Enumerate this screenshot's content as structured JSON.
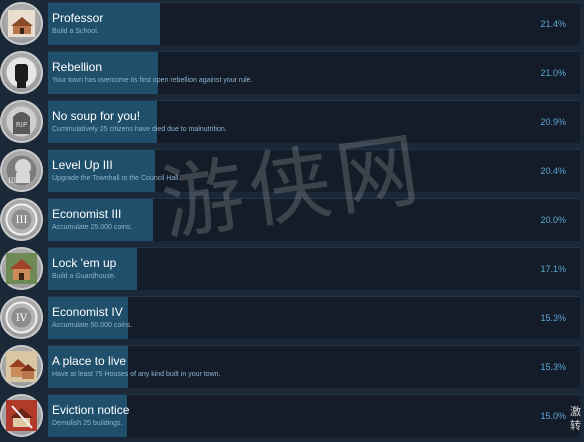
{
  "achievements": [
    {
      "title": "Professor",
      "description": "Build a School.",
      "percent": "21.4%",
      "fill": 0.214,
      "icon": "school-building-icon"
    },
    {
      "title": "Rebellion",
      "description": "Your town has overcome its first open rebellion against your rule.",
      "percent": "21.0%",
      "fill": 0.21,
      "icon": "raised-fist-icon"
    },
    {
      "title": "No soup for you!",
      "description": "Cummulatively 25 citizens have died due to malnutrition.",
      "percent": "20.9%",
      "fill": 0.209,
      "icon": "gravestone-rip-icon"
    },
    {
      "title": "Level Up III",
      "description": "Upgrade the Townhall to the Council Hall.",
      "percent": "20.4%",
      "fill": 0.204,
      "icon": "lion-emblem-icon"
    },
    {
      "title": "Economist III",
      "description": "Accumulate 25.000 coins.",
      "percent": "20.0%",
      "fill": 0.2,
      "icon": "coin-roman-three-icon"
    },
    {
      "title": "Lock 'em up",
      "description": "Build a Guardhouse.",
      "percent": "17.1%",
      "fill": 0.171,
      "icon": "guardhouse-icon"
    },
    {
      "title": "Economist IV",
      "description": "Accumulate 50.000 coins.",
      "percent": "15.3%",
      "fill": 0.153,
      "icon": "coin-roman-four-icon"
    },
    {
      "title": "A place to live",
      "description": "Have at least 75 Houses of any kind built in your town.",
      "percent": "15.3%",
      "fill": 0.153,
      "icon": "houses-icon"
    },
    {
      "title": "Eviction notice",
      "description": "Demolish 25 buildings.",
      "percent": "15.0%",
      "fill": 0.15,
      "icon": "demolished-house-icon"
    }
  ],
  "watermark": "游侠网",
  "corner_text": "激转",
  "colors": {
    "background": "#1b2838",
    "panel": "#131c28",
    "progress_fill": "#1f4f6b",
    "percent_text": "#5fa8d6",
    "description_text": "#8fb3cf"
  }
}
